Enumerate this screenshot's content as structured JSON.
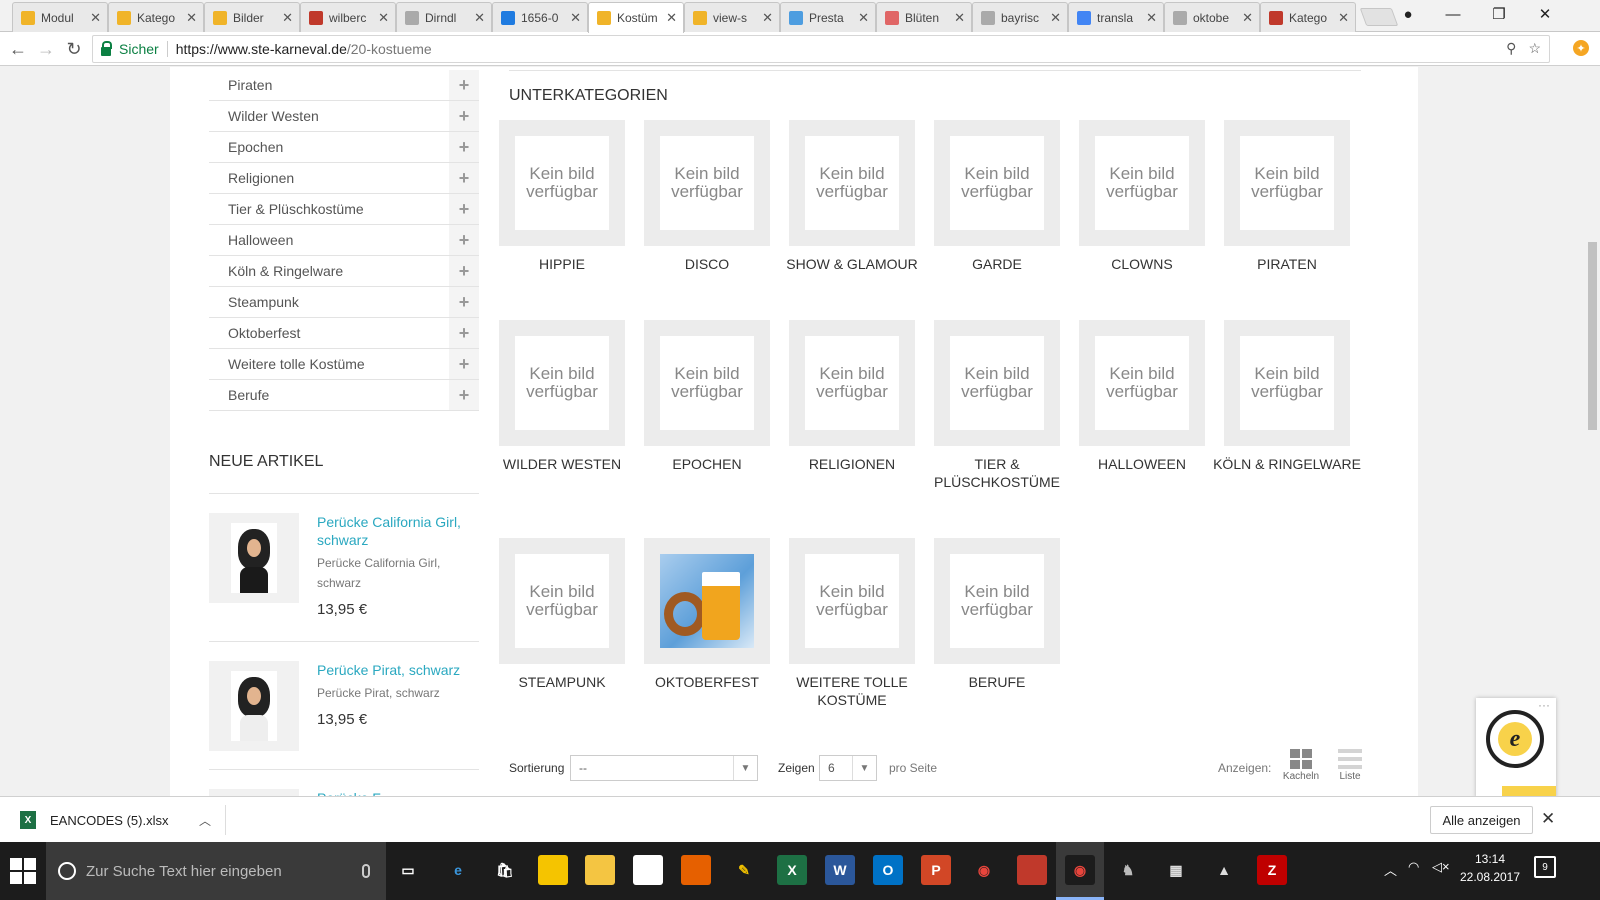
{
  "browser": {
    "tabs": [
      {
        "title": "Modul",
        "fav": "#f0b429"
      },
      {
        "title": "Katego",
        "fav": "#f0b429"
      },
      {
        "title": "Bilder",
        "fav": "#f0b429"
      },
      {
        "title": "wilberc",
        "fav": "#c0392b"
      },
      {
        "title": "Dirndl",
        "fav": "#aaaaaa"
      },
      {
        "title": "1656-0",
        "fav": "#1f7be0"
      },
      {
        "title": "Kostüm",
        "fav": "#f0b429",
        "active": true
      },
      {
        "title": "view-s",
        "fav": "#f0b429"
      },
      {
        "title": "Presta",
        "fav": "#4d9de0"
      },
      {
        "title": "Blüten",
        "fav": "#e06666"
      },
      {
        "title": "bayrisc",
        "fav": "#aaaaaa"
      },
      {
        "title": "transla",
        "fav": "#4285f4"
      },
      {
        "title": "oktobe",
        "fav": "#aaaaaa"
      },
      {
        "title": "Katego",
        "fav": "#c0392b"
      }
    ],
    "close_glyph": "✕",
    "secure_label": "Sicher",
    "url_host": "https://www.ste-karneval.de",
    "url_path": "/20-kostueme"
  },
  "sidebar": {
    "categories": [
      "Piraten",
      "Wilder Westen",
      "Epochen",
      "Religionen",
      "Tier & Plüschkostüme",
      "Halloween",
      "Köln & Ringelware",
      "Steampunk",
      "Oktoberfest",
      "Weitere tolle Kostüme",
      "Berufe"
    ],
    "neue_title": "NEUE ARTIKEL",
    "products": [
      {
        "name": "Perücke California Girl, schwarz",
        "desc": "Perücke California Girl, schwarz",
        "price": "13,95 €"
      },
      {
        "name": "Perücke Pirat, schwarz",
        "desc": "Perücke Pirat, schwarz",
        "price": "13,95 €"
      },
      {
        "name": "Perücke F...",
        "desc": "",
        "price": ""
      }
    ]
  },
  "main": {
    "subcategories_title": "UNTERKATEGORIEN",
    "no_image_text": "Kein bild verfügbar",
    "subcategories": [
      {
        "label": "HIPPIE"
      },
      {
        "label": "DISCO"
      },
      {
        "label": "SHOW & GLAMOUR"
      },
      {
        "label": "GARDE"
      },
      {
        "label": "CLOWNS"
      },
      {
        "label": "PIRATEN"
      },
      {
        "label": "WILDER WESTEN"
      },
      {
        "label": "EPOCHEN"
      },
      {
        "label": "RELIGIONEN"
      },
      {
        "label": "TIER & PLÜSCHKOSTÜME"
      },
      {
        "label": "HALLOWEEN"
      },
      {
        "label": "KÖLN & RINGELWARE"
      },
      {
        "label": "STEAMPUNK"
      },
      {
        "label": "OKTOBERFEST",
        "has_image": true
      },
      {
        "label": "WEITERE TOLLE KOSTÜME"
      },
      {
        "label": "BERUFE"
      }
    ],
    "sort_label": "Sortierung",
    "sort_value": "--",
    "show_label": "Zeigen",
    "show_value": "6",
    "per_page_label": "pro Seite",
    "display_label": "Anzeigen:",
    "view_grid_label": "Kacheln",
    "view_list_label": "Liste"
  },
  "download_shelf": {
    "file_name": "EANCODES (5).xlsx",
    "show_all_label": "Alle anzeigen"
  },
  "taskbar": {
    "search_placeholder": "Zur Suche Text hier eingeben",
    "time": "13:14",
    "date": "22.08.2017",
    "notification_count": "9",
    "apps": [
      {
        "name": "task-view-icon",
        "color": "#1c1c1c",
        "glyph": "▭"
      },
      {
        "name": "edge-icon",
        "color": "#1c1c1c",
        "glyph": "e",
        "fg": "#3a96dd"
      },
      {
        "name": "store-icon",
        "color": "#1c1c1c",
        "glyph": "🛍"
      },
      {
        "name": "sticky-notes-icon",
        "color": "#f5c400",
        "glyph": ""
      },
      {
        "name": "file-explorer-icon",
        "color": "#f4c542",
        "glyph": ""
      },
      {
        "name": "calculator-grid-icon",
        "color": "#ffffff",
        "glyph": ""
      },
      {
        "name": "firefox-icon",
        "color": "#e66000",
        "glyph": ""
      },
      {
        "name": "paint-tool-icon",
        "color": "#1c1c1c",
        "glyph": "✎",
        "fg": "#f0c000"
      },
      {
        "name": "excel-icon",
        "color": "#1d7044",
        "glyph": "X"
      },
      {
        "name": "word-icon",
        "color": "#2b579a",
        "glyph": "W"
      },
      {
        "name": "outlook-icon",
        "color": "#0072c6",
        "glyph": "O"
      },
      {
        "name": "powerpoint-icon",
        "color": "#d24726",
        "glyph": "P"
      },
      {
        "name": "chrome-icon",
        "color": "#1c1c1c",
        "glyph": "◉",
        "fg": "#e8453c"
      },
      {
        "name": "ftp-manager-icon",
        "color": "#c0392b",
        "glyph": ""
      },
      {
        "name": "chrome-active-icon",
        "color": "#1c1c1c",
        "glyph": "◉",
        "fg": "#e8453c"
      },
      {
        "name": "game-icon",
        "color": "#1c1c1c",
        "glyph": "♞",
        "fg": "#bbb"
      },
      {
        "name": "calculator-icon",
        "color": "#1c1c1c",
        "glyph": "▦",
        "fg": "#ddd"
      },
      {
        "name": "photos-icon",
        "color": "#1c1c1c",
        "glyph": "▲",
        "fg": "#ddd"
      },
      {
        "name": "filezilla-icon",
        "color": "#bf0000",
        "glyph": "Z"
      }
    ]
  }
}
